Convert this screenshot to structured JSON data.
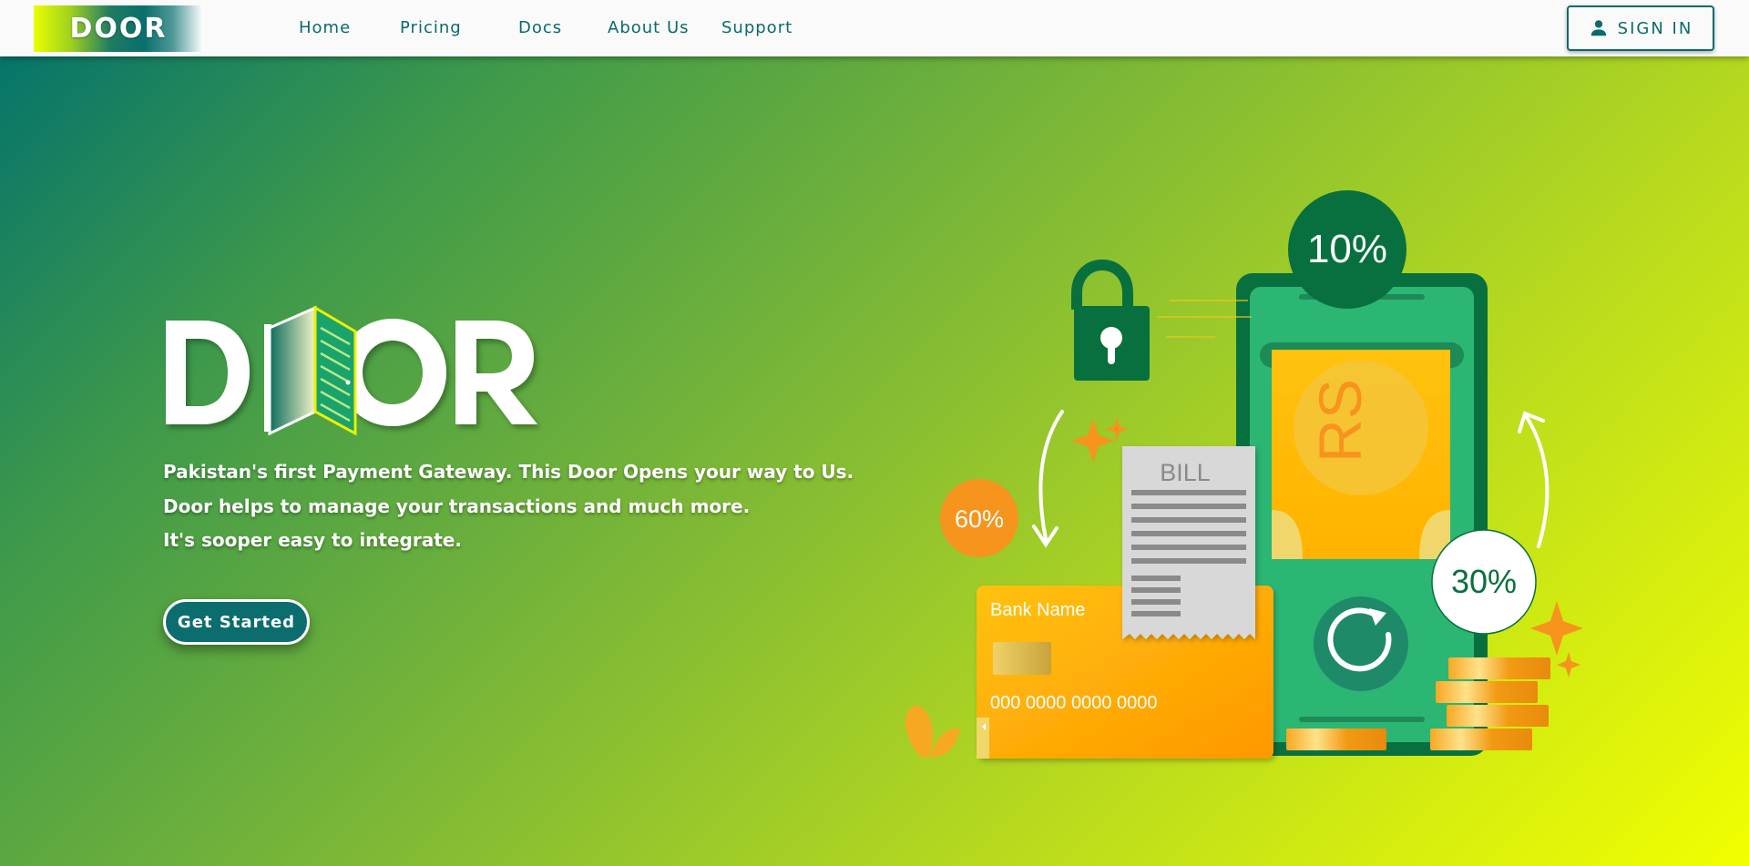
{
  "header": {
    "logo_text": "DOOR",
    "nav": [
      {
        "label": "Home"
      },
      {
        "label": "Pricing"
      },
      {
        "label": "Docs"
      },
      {
        "label": "About Us"
      },
      {
        "label": "Support"
      }
    ],
    "signin_label": "SIGN IN",
    "signin_icon": "person-icon"
  },
  "hero": {
    "logo_text": "DOOR",
    "lines": [
      "Pakistan's first Payment Gateway. This Door Opens your way to Us.",
      "Door helps to manage your transactions and much more.",
      "It's sooper easy to integrate."
    ],
    "cta_label": "Get Started"
  },
  "illustration": {
    "badge_top": "10%",
    "badge_left": "60%",
    "badge_right": "30%",
    "bill_label": "BILL",
    "currency_label": "RS",
    "card_bank": "Bank Name",
    "card_number": "000 0000 0000 0000"
  },
  "colors": {
    "brand_teal": "#0b6a6a",
    "phone_green": "#2bb673",
    "dark_green": "#08703e",
    "orange": "#f7941d",
    "gold": "#ffc20e"
  }
}
